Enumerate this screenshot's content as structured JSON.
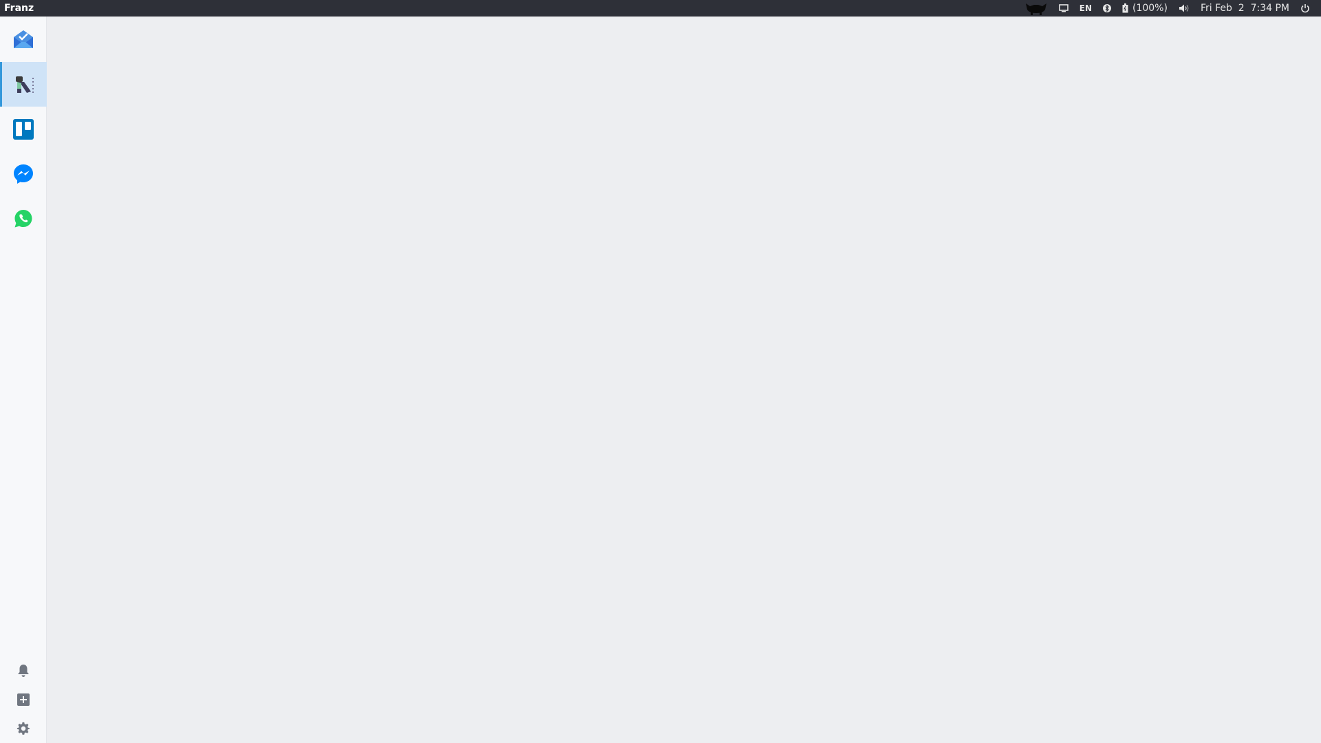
{
  "topbar": {
    "app_title": "Franz",
    "indicators": {
      "language": "EN",
      "battery": "(100%)",
      "clock": "Fri Feb  2  7:34 PM"
    },
    "icons": [
      "cat-icon",
      "display-icon",
      "bluetooth-icon",
      "battery-icon",
      "volume-icon",
      "power-icon"
    ]
  },
  "sidebar": {
    "services": [
      {
        "name": "inbox",
        "icon": "inbox-envelope-icon",
        "active": false
      },
      {
        "name": "reelo",
        "icon": "reelo-icon",
        "active": true
      },
      {
        "name": "trello",
        "icon": "trello-icon",
        "active": false
      },
      {
        "name": "messenger",
        "icon": "messenger-icon",
        "active": false
      },
      {
        "name": "whatsapp",
        "icon": "whatsapp-icon",
        "active": false
      }
    ],
    "tools": [
      "bell-icon",
      "add-service-icon",
      "settings-gear-icon"
    ]
  },
  "colors": {
    "topbar_bg": "#2e3038",
    "sidebar_bg": "#f7f8fa",
    "content_bg": "#edeef1",
    "active_bg": "#cfe3f7",
    "active_accent": "#3498db"
  }
}
